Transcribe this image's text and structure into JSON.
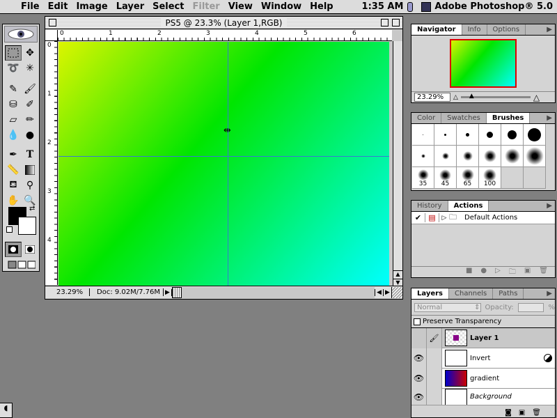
{
  "menubar": {
    "items": [
      "File",
      "Edit",
      "Image",
      "Layer",
      "Select",
      "Filter",
      "View",
      "Window",
      "Help"
    ],
    "disabled": [
      "Filter"
    ],
    "clock": "1:35 AM",
    "app_name": "Adobe Photoshop® 5.0"
  },
  "document": {
    "title": "PS5 @ 23.3% (Layer 1,RGB)",
    "ruler_top": [
      "0",
      "1",
      "2",
      "3",
      "4",
      "5",
      "6"
    ],
    "ruler_left": [
      "0",
      "1",
      "2",
      "3",
      "4"
    ],
    "zoom": "23.29%",
    "doc_size": "Doc: 9.02M/7.76M"
  },
  "navigator": {
    "tabs": [
      "Navigator",
      "Info",
      "Options"
    ],
    "zoom": "23.29%"
  },
  "brushes": {
    "tabs": [
      "Color",
      "Swatches",
      "Brushes"
    ],
    "labels": [
      "35",
      "45",
      "65",
      "100"
    ]
  },
  "actions": {
    "tabs": [
      "History",
      "Actions"
    ],
    "set_name": "Default Actions"
  },
  "layers": {
    "tabs": [
      "Layers",
      "Channels",
      "Paths"
    ],
    "blend_mode": "Normal",
    "opacity_label": "Opacity:",
    "opacity_unit": "%",
    "preserve_label": "Preserve Transparency",
    "items": [
      {
        "name": "Layer 1"
      },
      {
        "name": "Invert"
      },
      {
        "name": "gradient"
      },
      {
        "name": "Background"
      }
    ]
  }
}
